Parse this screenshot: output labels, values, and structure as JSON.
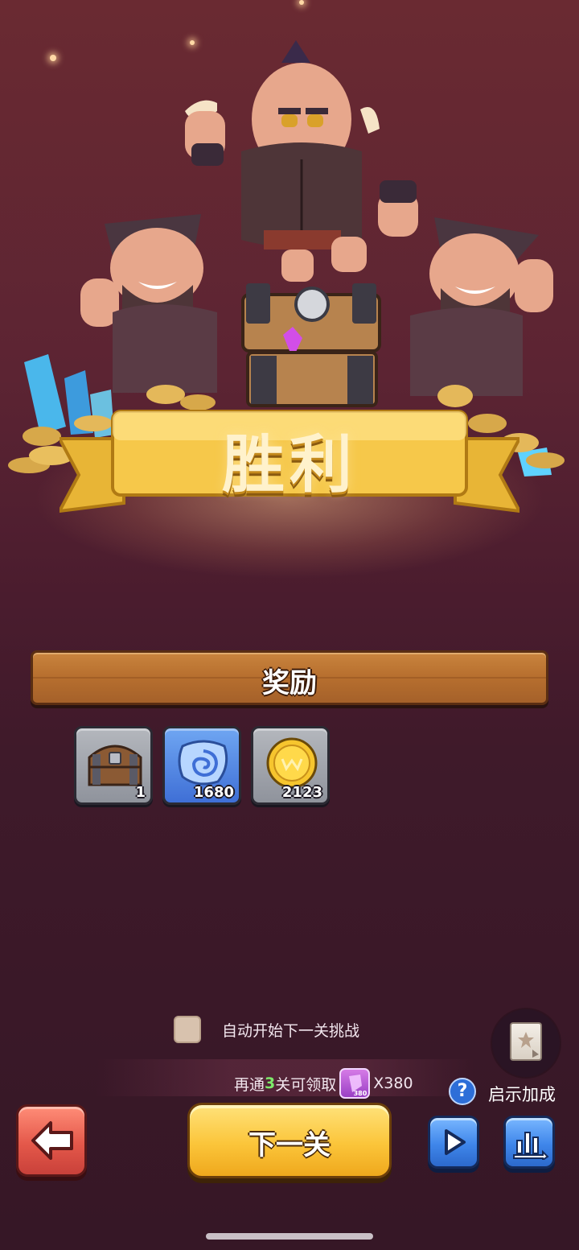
{
  "banner": {
    "title": "胜利"
  },
  "rewards": {
    "header": "奖励",
    "items": [
      {
        "icon": "treasure-chest-icon",
        "count": "1"
      },
      {
        "icon": "blue-spiral-gem-icon",
        "count": "1680"
      },
      {
        "icon": "gold-coin-icon",
        "count": "2123"
      }
    ]
  },
  "auto_next": {
    "label": "自动开始下一关挑战",
    "checked": false
  },
  "progress": {
    "prefix": "再通",
    "levels": "3",
    "suffix": "关可领取",
    "badge_number": "380",
    "amount": "X380"
  },
  "bonus": {
    "label": "启示加成",
    "help_symbol": "?"
  },
  "buttons": {
    "next_label": "下一关",
    "back_icon": "arrow-left-icon",
    "play_icon": "play-icon",
    "stats_icon": "bar-chart-icon"
  },
  "colors": {
    "accent_green": "#7dea6a",
    "primary_yellow": "#fbc53a",
    "back_red": "#e4584a",
    "secondary_blue": "#3f86ea"
  }
}
